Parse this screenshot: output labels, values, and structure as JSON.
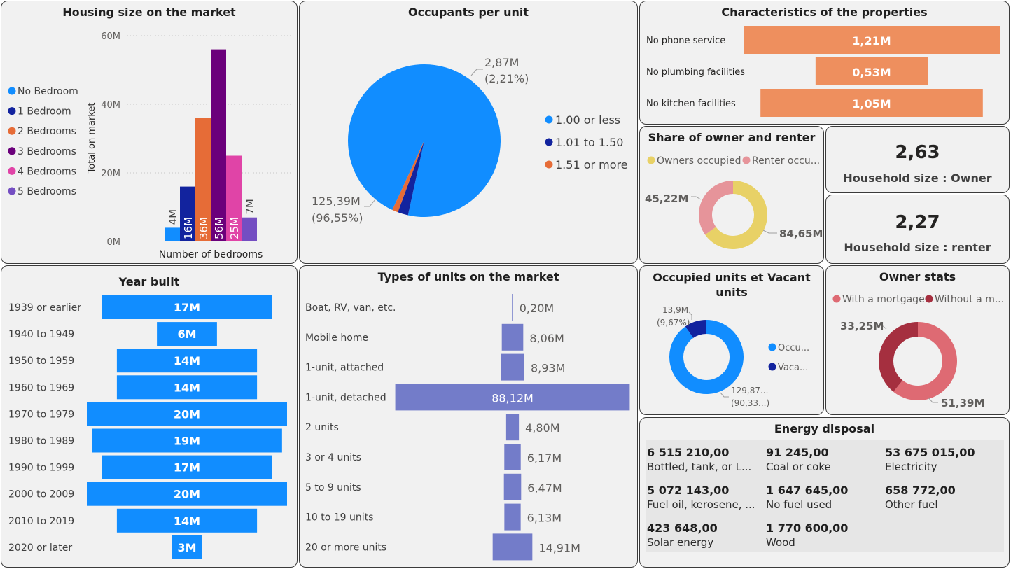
{
  "colors": {
    "blue": "#118DFF",
    "navy": "#12239E",
    "orange": "#E66C37",
    "purple": "#6B007B",
    "pink": "#E044A7",
    "violet": "#744EC2",
    "salmon": "#EE8F5E",
    "slate": "#737CC9",
    "yellow": "#E8D166",
    "rose": "#E6949A",
    "red": "#DE6A73",
    "darkred": "#A52F3F"
  },
  "housing": {
    "title": "Housing size on the market",
    "ylabel": "Total on market",
    "xlabel": "Number of bedrooms",
    "legend": [
      "No Bedroom",
      "1 Bedroom",
      "2 Bedrooms",
      "3 Bedrooms",
      "4 Bedrooms",
      "5 Bedrooms"
    ],
    "ticks": [
      "0M",
      "20M",
      "40M",
      "60M"
    ]
  },
  "occupants": {
    "title": "Occupants per unit",
    "legend": [
      "1.00 or less",
      "1.01 to 1.50",
      "1.51 or more"
    ],
    "label_small_1": "2,87M",
    "label_small_2": "(2,21%)",
    "label_big_1": "125,39M",
    "label_big_2": "(96,55%)"
  },
  "characteristics": {
    "title": "Characteristics of the properties"
  },
  "share": {
    "title": "Share of owner and renter",
    "legend": [
      "Owners occupied",
      "Renter occu..."
    ],
    "label_renter": "45,22M",
    "label_owner": "84,65M"
  },
  "kpi_owner": {
    "value": "2,63",
    "label": "Household size : Owner"
  },
  "kpi_renter": {
    "value": "2,27",
    "label": "Household size : renter"
  },
  "year": {
    "title": "Year built"
  },
  "types": {
    "title": "Types of units on the market"
  },
  "occupied": {
    "title_1": "Occupied units et Vacant",
    "title_2": "units",
    "legend": [
      "Occu...",
      "Vaca..."
    ],
    "label_vacant_1": "13,9M",
    "label_vacant_2": "(9,67%)",
    "label_occ_1": "129,87...",
    "label_occ_2": "(90,33...)"
  },
  "owner_stats": {
    "title": "Owner stats",
    "legend": [
      "With a mortgage",
      "Without a m..."
    ],
    "label_without": "33,25M",
    "label_with": "51,39M"
  },
  "energy": {
    "title": "Energy disposal",
    "items": [
      {
        "value": "6 515 210,00",
        "label": "Bottled, tank, or L..."
      },
      {
        "value": "91 245,00",
        "label": "Coal or coke"
      },
      {
        "value": "53 675 015,00",
        "label": "Electricity"
      },
      {
        "value": "5 072 143,00",
        "label": "Fuel oil, kerosene, ..."
      },
      {
        "value": "1 647 645,00",
        "label": "No fuel used"
      },
      {
        "value": "658 772,00",
        "label": "Other fuel"
      },
      {
        "value": "423 648,00",
        "label": "Solar energy"
      },
      {
        "value": "1 770 600,00",
        "label": "Wood"
      }
    ]
  },
  "chart_data": [
    {
      "type": "bar",
      "title": "Housing size on the market",
      "xlabel": "Number of bedrooms",
      "ylabel": "Total on market",
      "ylim": [
        0,
        60
      ],
      "categories": [
        "No Bedroom",
        "1 Bedroom",
        "2 Bedrooms",
        "3 Bedrooms",
        "4 Bedrooms",
        "5 Bedrooms"
      ],
      "values": [
        4,
        16,
        36,
        56,
        25,
        7
      ],
      "labels": [
        "4M",
        "16M",
        "36M",
        "56M",
        "25M",
        "7M"
      ],
      "legend": "left",
      "grid": true
    },
    {
      "type": "pie",
      "title": "Occupants per unit",
      "categories": [
        "1.00 or less",
        "1.01 to 1.50",
        "1.51 or more"
      ],
      "values": [
        125.39,
        2.87,
        1.6
      ],
      "legend": "right"
    },
    {
      "type": "bar",
      "title": "Characteristics of the properties",
      "categories": [
        "No phone service",
        "No plumbing facilities",
        "No kitchen facilities"
      ],
      "values": [
        1.21,
        0.53,
        1.05
      ],
      "labels": [
        "1,21M",
        "0,53M",
        "1,05M"
      ]
    },
    {
      "type": "pie",
      "title": "Share of owner and renter",
      "categories": [
        "Owners occupied",
        "Renter occu..."
      ],
      "values": [
        84.65,
        45.22
      ],
      "legend": "top"
    },
    {
      "type": "bar",
      "title": "Year built",
      "categories": [
        "1939 or earlier",
        "1940 to 1949",
        "1950 to 1959",
        "1960 to 1969",
        "1970 to 1979",
        "1980 to 1989",
        "1990 to 1999",
        "2000 to 2009",
        "2010 to 2019",
        "2020 or later"
      ],
      "values": [
        17,
        6,
        14,
        14,
        20,
        19,
        17,
        20,
        14,
        3
      ],
      "labels": [
        "17M",
        "6M",
        "14M",
        "14M",
        "20M",
        "19M",
        "17M",
        "20M",
        "14M",
        "3M"
      ]
    },
    {
      "type": "bar",
      "title": "Types of units on the market",
      "categories": [
        "Boat, RV, van, etc.",
        "Mobile home",
        "1-unit, attached",
        "1-unit, detached",
        "2 units",
        "3 or 4 units",
        "5 to 9 units",
        "10 to 19 units",
        "20 or more units"
      ],
      "values": [
        0.2,
        8.06,
        8.93,
        88.12,
        4.8,
        6.17,
        6.47,
        6.13,
        14.91
      ],
      "labels": [
        "0,20M",
        "8,06M",
        "8,93M",
        "88,12M",
        "4,80M",
        "6,17M",
        "6,47M",
        "6,13M",
        "14,91M"
      ]
    },
    {
      "type": "pie",
      "title": "Occupied units et Vacant units",
      "categories": [
        "Occu...",
        "Vaca..."
      ],
      "values": [
        129.87,
        13.9
      ],
      "legend": "right"
    },
    {
      "type": "pie",
      "title": "Owner stats",
      "categories": [
        "With a mortgage",
        "Without a m..."
      ],
      "values": [
        51.39,
        33.25
      ],
      "legend": "top"
    }
  ]
}
